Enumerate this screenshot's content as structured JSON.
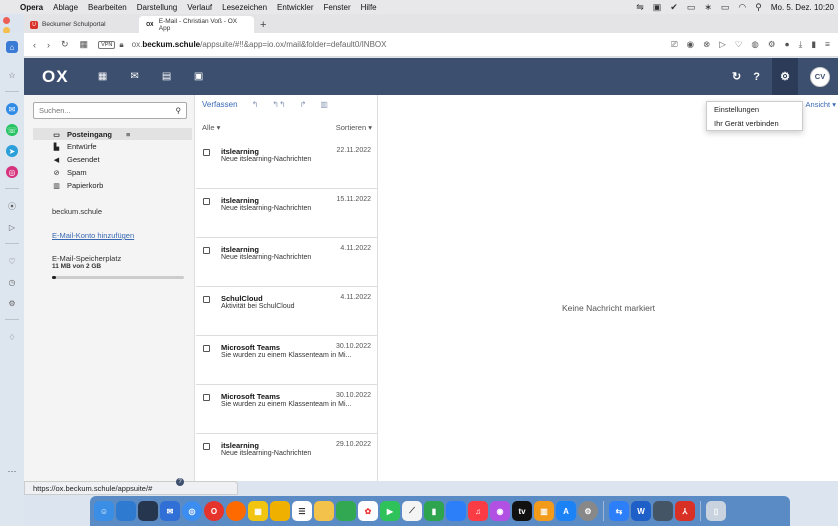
{
  "menubar": {
    "app": "Opera",
    "items": [
      "Ablage",
      "Bearbeiten",
      "Darstellung",
      "Verlauf",
      "Lesezeichen",
      "Entwickler",
      "Fenster",
      "Hilfe"
    ],
    "clock": "Mo. 5. Dez. 10:20"
  },
  "tabs": [
    {
      "label": "Beckumer Schulportal"
    },
    {
      "label": "E-Mail - Christian Voß - OX App"
    }
  ],
  "address": {
    "vpn": "VPN",
    "url_prefix": "ox.",
    "url_domain": "beckum.schule",
    "url_path": "/appsuite/#!!&app=io.ox/mail&folder=default0/INBOX"
  },
  "header": {
    "logo": "OX",
    "avatar": "CV",
    "refresh": "↻",
    "help": "?"
  },
  "search": {
    "placeholder": "Suchen..."
  },
  "folders": {
    "inbox": "Posteingang",
    "drafts": "Entwürfe",
    "sent": "Gesendet",
    "spam": "Spam",
    "trash": "Papierkorb"
  },
  "account": "beckum.schule",
  "add_account": "E-Mail-Konto hinzufügen",
  "quota": {
    "label": "E-Mail-Speicherplatz",
    "value": "11 MB von 2 GB",
    "fraction": 0.0055
  },
  "toolbar": {
    "compose": "Verfassen",
    "view": "Ansicht"
  },
  "list": {
    "filter": "Alle",
    "sort": "Sortieren"
  },
  "mails": [
    {
      "from": "itslearning",
      "date": "22.11.2022",
      "subject": "Neue itslearning-Nachrichten"
    },
    {
      "from": "itslearning",
      "date": "15.11.2022",
      "subject": "Neue itslearning-Nachrichten"
    },
    {
      "from": "itslearning",
      "date": "4.11.2022",
      "subject": "Neue itslearning-Nachrichten"
    },
    {
      "from": "SchulCloud",
      "date": "4.11.2022",
      "subject": "Aktivität bei SchulCloud"
    },
    {
      "from": "Microsoft Teams",
      "date": "30.10.2022",
      "subject": "Sie wurden zu einem Klassenteam in Mi..."
    },
    {
      "from": "Microsoft Teams",
      "date": "30.10.2022",
      "subject": "Sie wurden zu einem Klassenteam in Mi..."
    },
    {
      "from": "itslearning",
      "date": "29.10.2022",
      "subject": "Neue itslearning-Nachrichten"
    }
  ],
  "reading": {
    "empty": "Keine Nachricht markiert"
  },
  "dropdown": {
    "settings": "Einstellungen",
    "connect": "Ihr Gerät verbinden"
  },
  "status_url": "https://ox.beckum.schule/appsuite/#",
  "colors": {
    "header": "#3c4f6e",
    "link": "#3868b3"
  }
}
